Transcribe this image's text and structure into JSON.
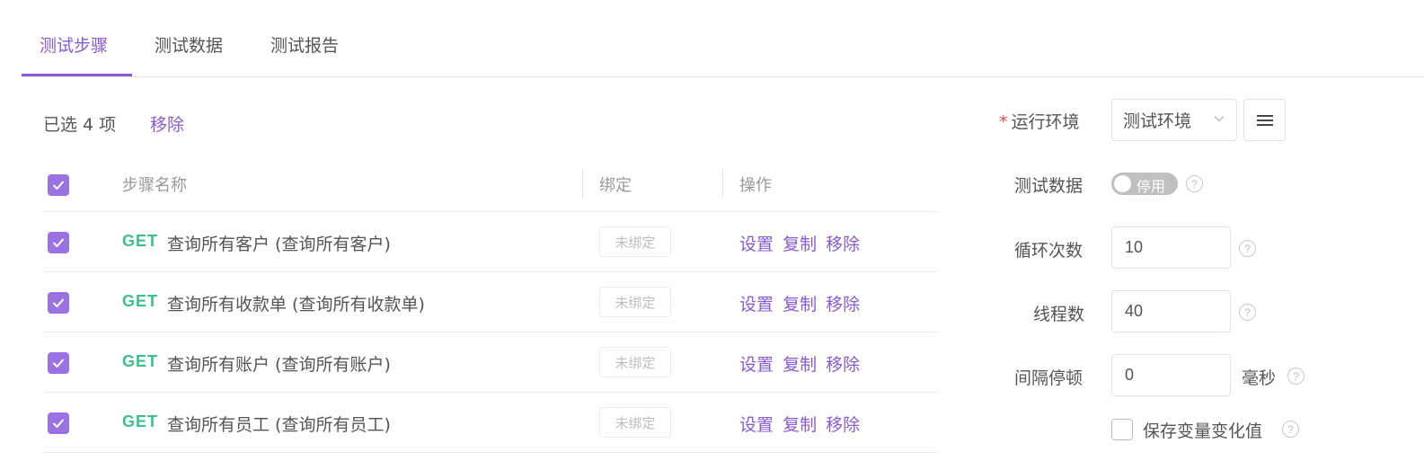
{
  "tabs": [
    {
      "label": "测试步骤",
      "active": true
    },
    {
      "label": "测试数据",
      "active": false
    },
    {
      "label": "测试报告",
      "active": false
    }
  ],
  "selection": {
    "count_text": "已选 4 项",
    "remove_label": "移除"
  },
  "table": {
    "headers": {
      "name": "步骤名称",
      "binding": "绑定",
      "actions": "操作"
    },
    "rows": [
      {
        "method": "GET",
        "name": "查询所有客户 (查询所有客户)",
        "binding": "未绑定",
        "checked": true
      },
      {
        "method": "GET",
        "name": "查询所有收款单 (查询所有收款单)",
        "binding": "未绑定",
        "checked": true
      },
      {
        "method": "GET",
        "name": "查询所有账户 (查询所有账户)",
        "binding": "未绑定",
        "checked": true
      },
      {
        "method": "GET",
        "name": "查询所有员工 (查询所有员工)",
        "binding": "未绑定",
        "checked": true
      }
    ],
    "actions": [
      "设置",
      "复制",
      "移除"
    ]
  },
  "settings": {
    "environment": {
      "required_mark": "*",
      "label": "运行环境",
      "value": "测试环境"
    },
    "test_data": {
      "label": "测试数据",
      "toggle_text": "停用",
      "enabled": false
    },
    "loops": {
      "label": "循环次数",
      "value": "10"
    },
    "threads": {
      "label": "线程数",
      "value": "40"
    },
    "interval": {
      "label": "间隔停顿",
      "value": "0",
      "unit": "毫秒"
    },
    "save_vars": {
      "label": "保存变量变化值",
      "checked": false
    },
    "help_glyph": "?"
  },
  "colors": {
    "accent": "#8a5bd6",
    "method_get": "#3ebf8e",
    "checkbox": "#9b72e3",
    "required": "#e24b57"
  }
}
